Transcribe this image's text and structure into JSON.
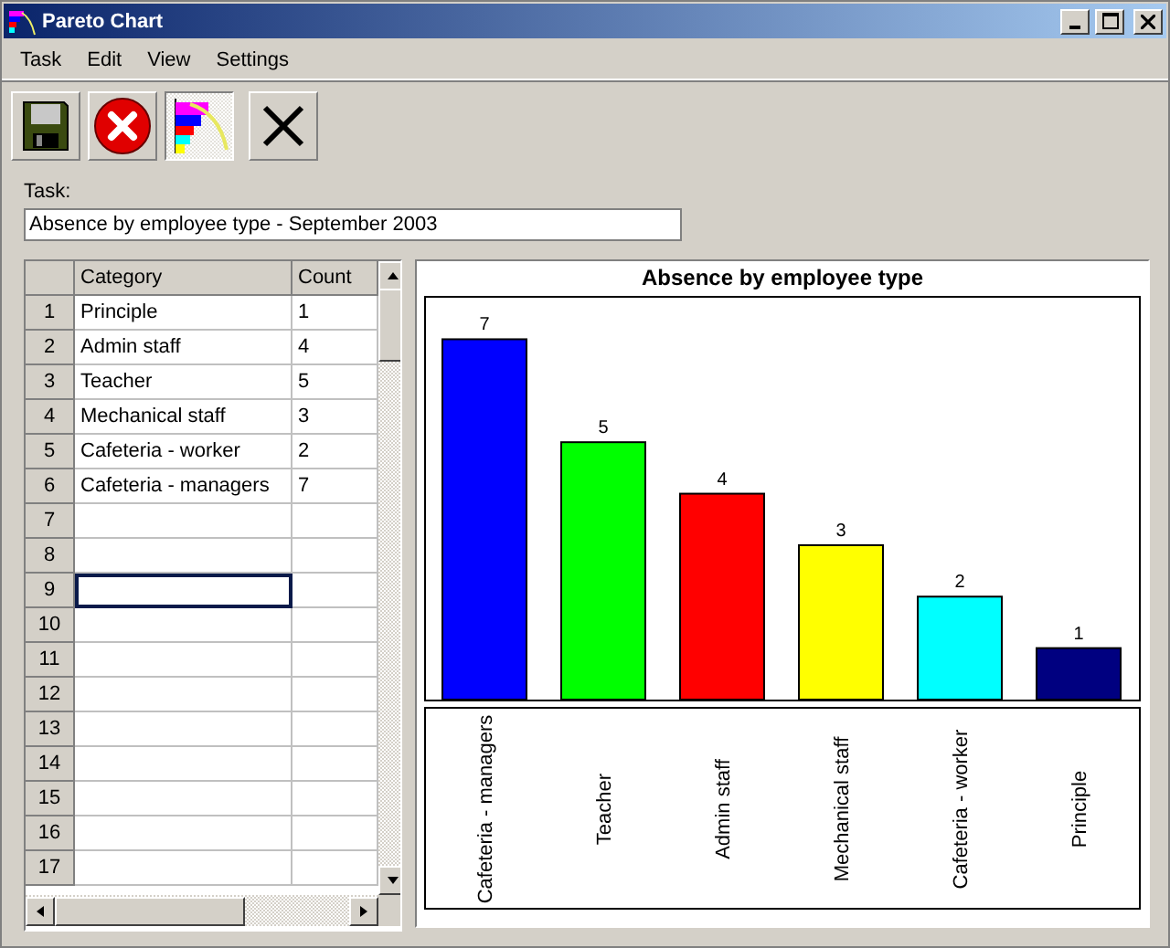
{
  "window": {
    "title": "Pareto Chart"
  },
  "menu": [
    "Task",
    "Edit",
    "View",
    "Settings"
  ],
  "toolbar": [
    {
      "kind": "save",
      "selected": false
    },
    {
      "kind": "cancel",
      "selected": false
    },
    {
      "kind": "chart",
      "selected": true
    },
    {
      "kind": "delete",
      "selected": false
    }
  ],
  "task": {
    "label": "Task:",
    "value": "Absence by employee type - September 2003"
  },
  "table": {
    "columns": [
      "Category",
      "Count"
    ],
    "rows": [
      {
        "number": "1",
        "category": "Principle",
        "count": "1",
        "selected": false
      },
      {
        "number": "2",
        "category": "Admin staff",
        "count": "4",
        "selected": false
      },
      {
        "number": "3",
        "category": "Teacher",
        "count": "5",
        "selected": false
      },
      {
        "number": "4",
        "category": "Mechanical staff",
        "count": "3",
        "selected": false
      },
      {
        "number": "5",
        "category": "Cafeteria - worker",
        "count": "2",
        "selected": false
      },
      {
        "number": "6",
        "category": "Cafeteria - managers",
        "count": "7",
        "selected": false
      },
      {
        "number": "7",
        "selected": false
      },
      {
        "number": "8",
        "selected": false
      },
      {
        "number": "9",
        "selected": true
      },
      {
        "number": "10",
        "selected": false
      },
      {
        "number": "11",
        "selected": false
      },
      {
        "number": "12",
        "selected": false
      },
      {
        "number": "13",
        "selected": false
      },
      {
        "number": "14",
        "selected": false
      },
      {
        "number": "15",
        "selected": false
      },
      {
        "number": "16",
        "selected": false
      },
      {
        "number": "17",
        "selected": false
      }
    ]
  },
  "chart": {
    "chart_data": {
      "type": "bar",
      "title": "Absence by employee type",
      "categories": [
        "Cafeteria - managers",
        "Teacher",
        "Admin staff",
        "Mechanical staff",
        "Cafeteria - worker",
        "Principle"
      ],
      "series": [
        {
          "color": "#0000ff",
          "values": [
            7,
            null,
            null,
            null,
            null,
            null
          ]
        },
        {
          "color": "#00ff00",
          "values": [
            null,
            5,
            null,
            null,
            null,
            null
          ]
        },
        {
          "color": "#ff0000",
          "values": [
            null,
            null,
            4,
            null,
            null,
            null
          ]
        },
        {
          "color": "#ffff00",
          "values": [
            null,
            null,
            null,
            3,
            null,
            null
          ]
        },
        {
          "color": "#00ffff",
          "values": [
            null,
            null,
            null,
            null,
            2,
            null
          ]
        },
        {
          "color": "#000080",
          "values": [
            null,
            null,
            null,
            null,
            null,
            1
          ]
        }
      ],
      "stacked": true,
      "data_labels": true
    }
  }
}
